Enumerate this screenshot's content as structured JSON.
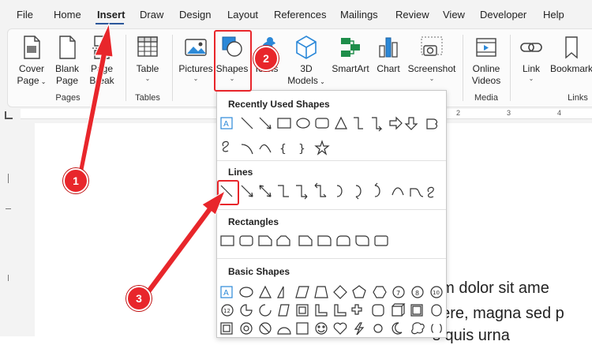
{
  "menu": {
    "tabs": [
      {
        "label": "File"
      },
      {
        "label": "Home"
      },
      {
        "label": "Insert"
      },
      {
        "label": "Draw"
      },
      {
        "label": "Design"
      },
      {
        "label": "Layout"
      },
      {
        "label": "References"
      },
      {
        "label": "Mailings"
      },
      {
        "label": "Review"
      },
      {
        "label": "View"
      },
      {
        "label": "Developer"
      },
      {
        "label": "Help"
      }
    ],
    "active": "Insert"
  },
  "ribbon": {
    "cover_page": {
      "line1": "Cover",
      "line2": "Page"
    },
    "blank_page": {
      "line1": "Blank",
      "line2": "Page"
    },
    "page_break": {
      "line1": "Page",
      "line2": "Break"
    },
    "table": {
      "label": "Table"
    },
    "pictures": {
      "label": "Pictures"
    },
    "shapes": {
      "label": "Shapes"
    },
    "icons": {
      "label": "Icons"
    },
    "models3d": {
      "line1": "3D",
      "line2": "Models"
    },
    "smartart": {
      "label": "SmartArt"
    },
    "chart": {
      "label": "Chart"
    },
    "screenshot": {
      "label": "Screenshot"
    },
    "online_videos": {
      "line1": "Online",
      "line2": "Videos"
    },
    "link": {
      "label": "Link"
    },
    "bookmark": {
      "label": "Bookmark"
    },
    "groups": {
      "pages": "Pages",
      "tables": "Tables",
      "media": "Media",
      "links": "Links"
    }
  },
  "dropdown": {
    "recently_used": "Recently Used Shapes",
    "lines": "Lines",
    "rectangles": "Rectangles",
    "basic_shapes": "Basic Shapes"
  },
  "ruler": {
    "t2": "2",
    "t3": "3",
    "t4": "4"
  },
  "document": {
    "line1": "um dolor sit ame",
    "line2": "uere, magna sed p",
    "line3": "s quis urna"
  },
  "annotations": {
    "n1": "1",
    "n2": "2",
    "n3": "3"
  },
  "colors": {
    "annotation": "#e8262b",
    "accent": "#2b579a",
    "smartart": "#1e8e4a"
  }
}
